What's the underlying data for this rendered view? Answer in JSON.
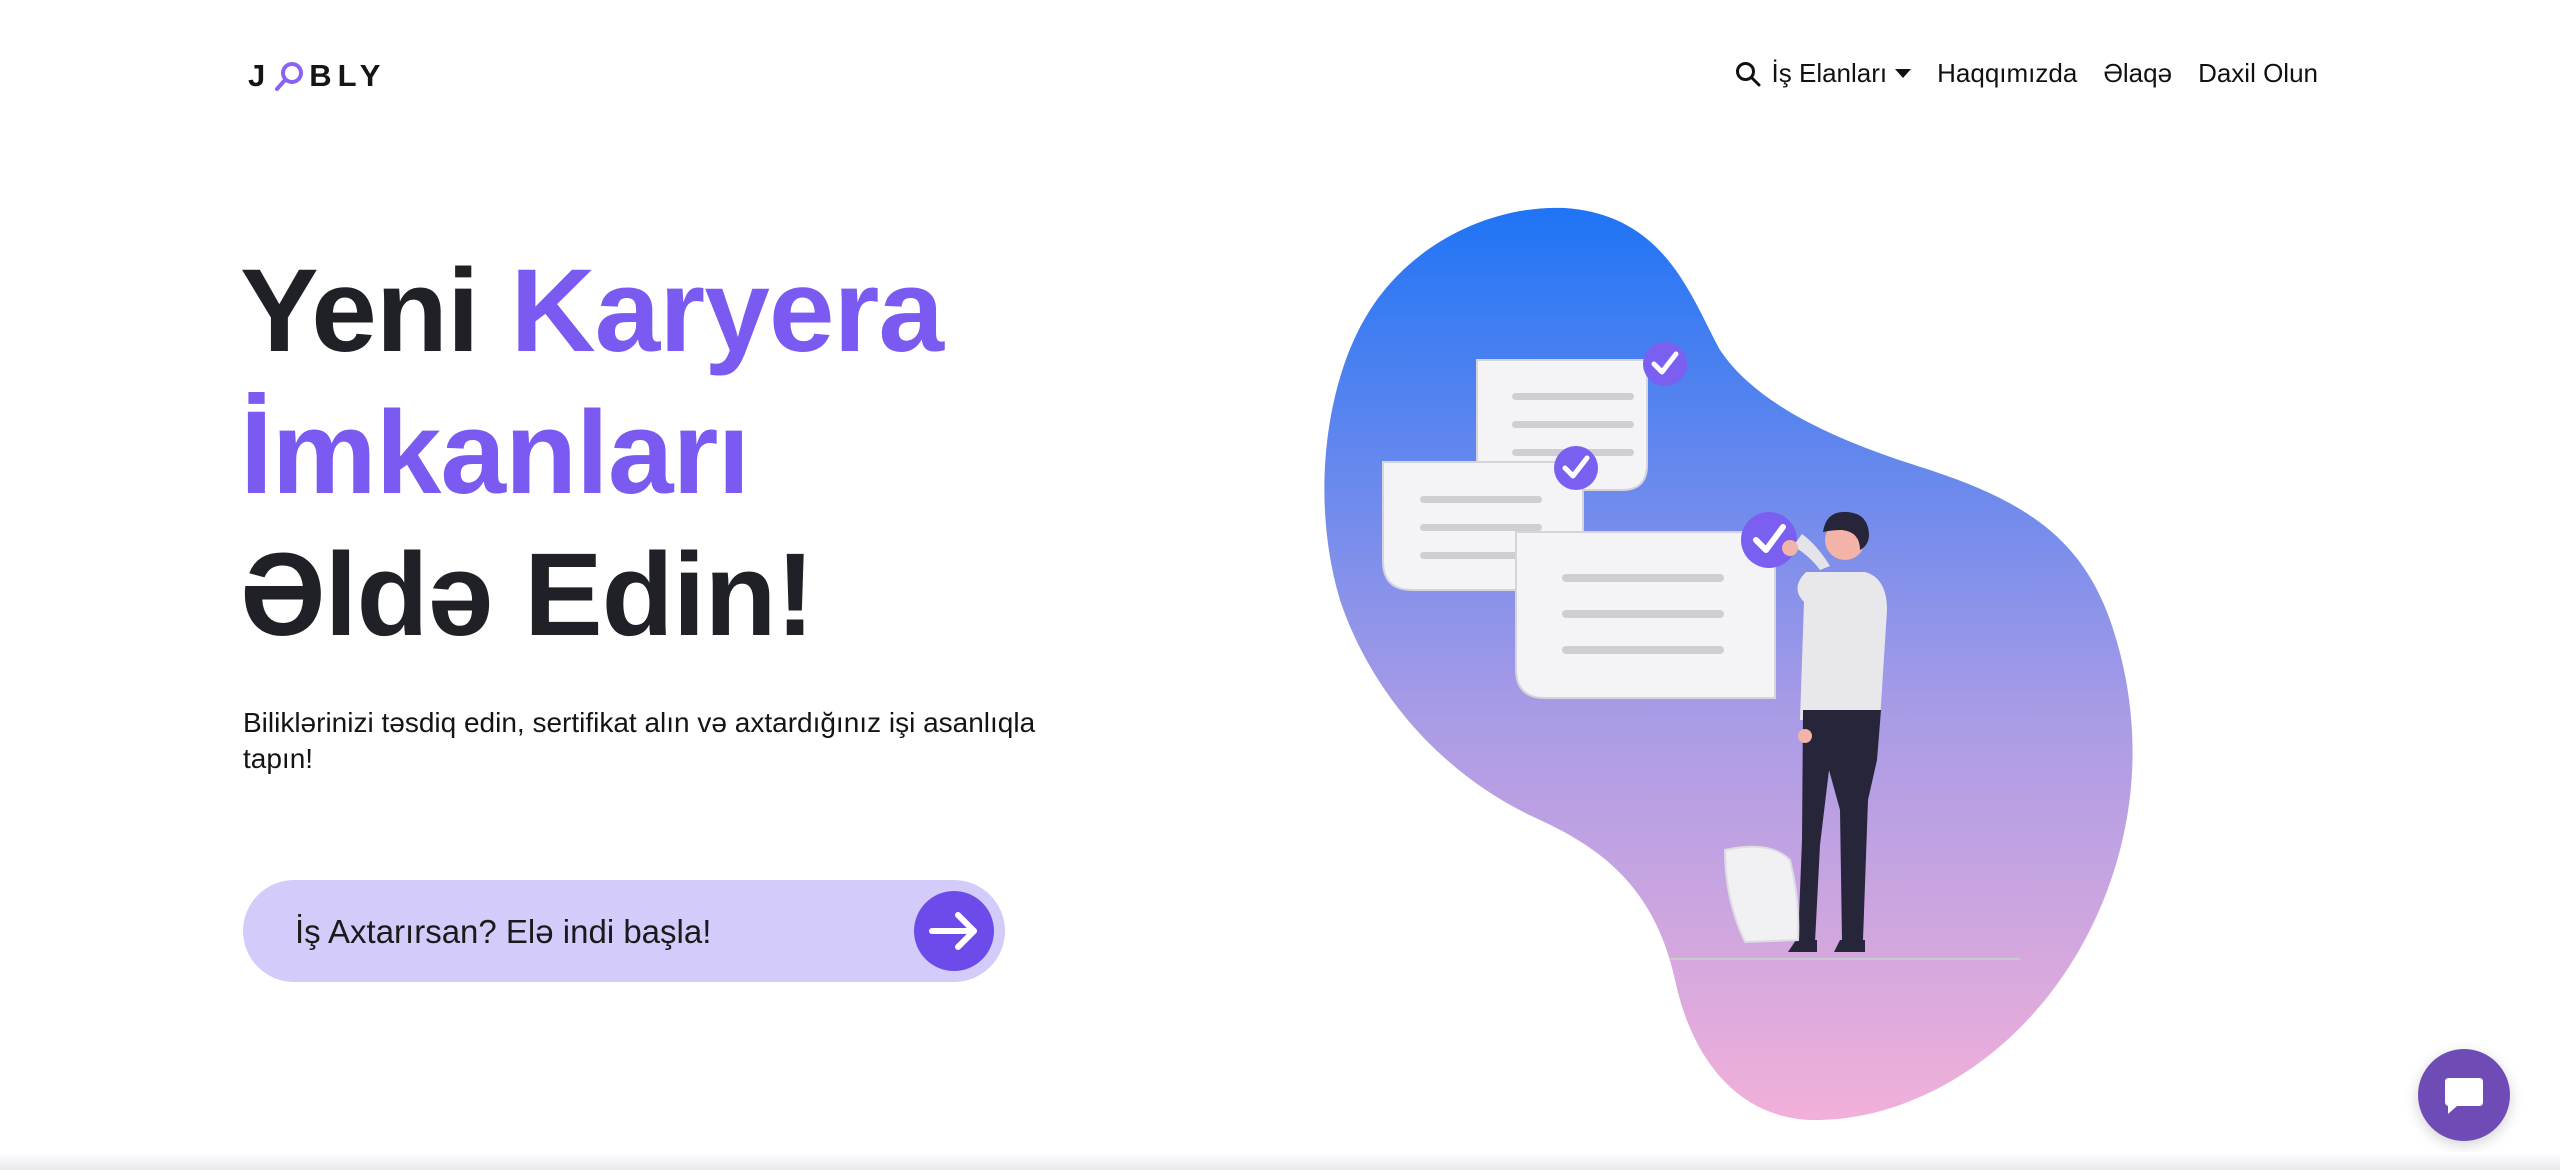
{
  "brand": {
    "logo_left": "J",
    "logo_right": "BLY",
    "accent_color": "#7a5af0",
    "dark_color": "#1f2126"
  },
  "nav": {
    "search_icon": "search-icon",
    "jobs": "İş Elanları",
    "about": "Haqqımızda",
    "contact": "Əlaqə",
    "login": "Daxil Olun"
  },
  "hero": {
    "title_part1": "Yeni ",
    "title_part2": "Karyera",
    "title_line2": "İmkanları",
    "title_line3": "Əldə Edin!",
    "subtitle": "Biliklərinizi təsdiq edin, sertifikat alın və axtardığınız işi asanlıqla tapın!",
    "cta_label": "İş Axtarırsan? Elə indi başla!",
    "cta_icon": "arrow-right-icon"
  },
  "illustration": {
    "gradient_top": "#1f74f5",
    "gradient_bottom": "#f2b0d9",
    "check_color": "#7b5ff0"
  },
  "chat": {
    "icon": "chat-bubble-icon",
    "color": "#6f4bb6"
  }
}
